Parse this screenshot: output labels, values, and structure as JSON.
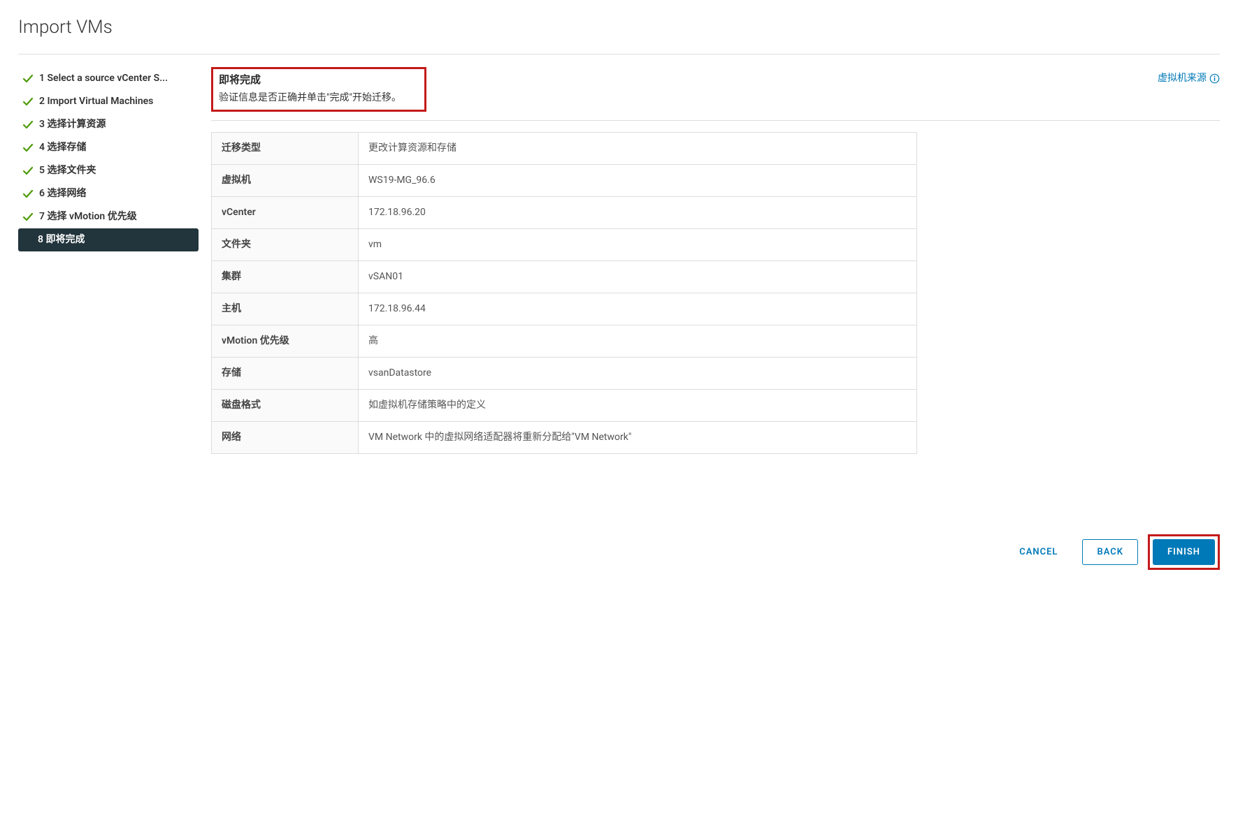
{
  "page_title": "Import VMs",
  "wizard_steps": [
    {
      "num": "1",
      "label": "Select a source vCenter S..."
    },
    {
      "num": "2",
      "label": "Import Virtual Machines"
    },
    {
      "num": "3",
      "label": "选择计算资源"
    },
    {
      "num": "4",
      "label": "选择存储"
    },
    {
      "num": "5",
      "label": "选择文件夹"
    },
    {
      "num": "6",
      "label": "选择网络"
    },
    {
      "num": "7",
      "label": "选择 vMotion 优先级"
    },
    {
      "num": "8",
      "label": "即将完成"
    }
  ],
  "header": {
    "title": "即将完成",
    "subtitle": "验证信息是否正确并单击\"完成\"开始迁移。",
    "source_link": "虚拟机来源"
  },
  "summary": [
    {
      "key": "迁移类型",
      "value": "更改计算资源和存储"
    },
    {
      "key": "虚拟机",
      "value": "WS19-MG_96.6"
    },
    {
      "key": "vCenter",
      "value": "172.18.96.20"
    },
    {
      "key": "文件夹",
      "value": "vm"
    },
    {
      "key": "集群",
      "value": "vSAN01"
    },
    {
      "key": "主机",
      "value": "172.18.96.44"
    },
    {
      "key": "vMotion 优先级",
      "value": "高"
    },
    {
      "key": "存储",
      "value": "vsanDatastore"
    },
    {
      "key": "磁盘格式",
      "value": "如虚拟机存储策略中的定义"
    },
    {
      "key": "网络",
      "value": "VM Network 中的虚拟网络适配器将重新分配给\"VM Network\""
    }
  ],
  "actions": {
    "cancel": "CANCEL",
    "back": "BACK",
    "finish": "FINISH"
  }
}
